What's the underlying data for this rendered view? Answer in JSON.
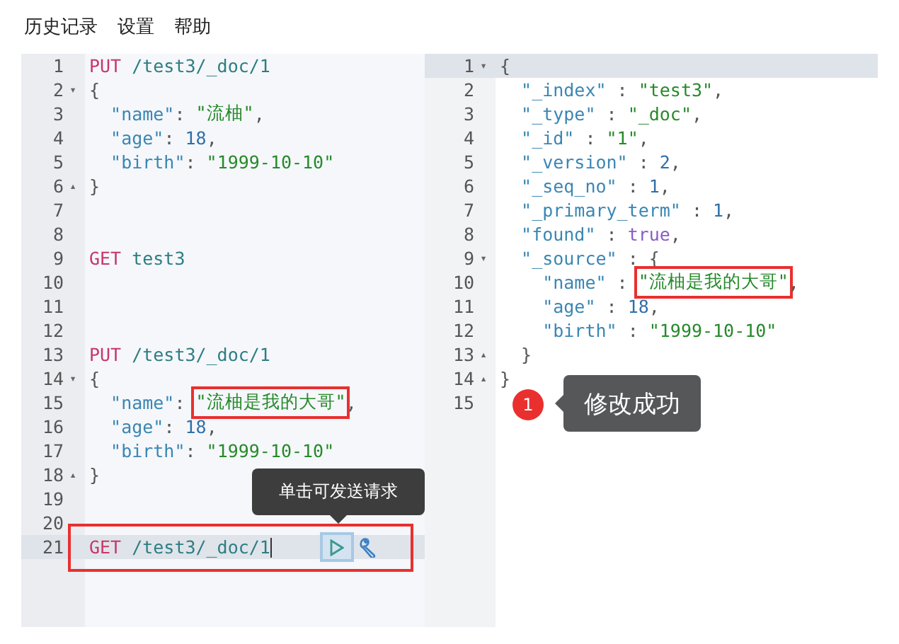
{
  "menu": [
    {
      "label": "历史记录"
    },
    {
      "label": "设置"
    },
    {
      "label": "帮助"
    }
  ],
  "request_editor": {
    "action_tooltip": "单击可发送请求",
    "lines": [
      {
        "number": "1",
        "selected": false,
        "tokens": [
          {
            "kind": "method",
            "text": "PUT"
          },
          {
            "kind": "url",
            "text": " /test3/_doc/1"
          }
        ]
      },
      {
        "number": "2",
        "selected": false,
        "fold": "▾",
        "tokens": [
          {
            "kind": "punct",
            "text": "{"
          }
        ]
      },
      {
        "number": "3",
        "selected": false,
        "tokens": [
          {
            "kind": "key",
            "text": "  \"name\""
          },
          {
            "kind": "punct",
            "text": ": "
          },
          {
            "kind": "string",
            "text": "\"流柚\""
          },
          {
            "kind": "punct",
            "text": ","
          }
        ]
      },
      {
        "number": "4",
        "selected": false,
        "tokens": [
          {
            "kind": "key",
            "text": "  \"age\""
          },
          {
            "kind": "punct",
            "text": ": "
          },
          {
            "kind": "number",
            "text": "18"
          },
          {
            "kind": "punct",
            "text": ","
          }
        ]
      },
      {
        "number": "5",
        "selected": false,
        "tokens": [
          {
            "kind": "key",
            "text": "  \"birth\""
          },
          {
            "kind": "punct",
            "text": ": "
          },
          {
            "kind": "string",
            "text": "\"1999-10-10\""
          }
        ]
      },
      {
        "number": "6",
        "selected": false,
        "fold": "▴",
        "tokens": [
          {
            "kind": "punct",
            "text": "}"
          }
        ]
      },
      {
        "number": "7",
        "selected": false
      },
      {
        "number": "8",
        "selected": false
      },
      {
        "number": "9",
        "selected": false,
        "tokens": [
          {
            "kind": "method",
            "text": "GET"
          },
          {
            "kind": "url",
            "text": " test3"
          }
        ]
      },
      {
        "number": "10",
        "selected": false
      },
      {
        "number": "11",
        "selected": false
      },
      {
        "number": "12",
        "selected": false
      },
      {
        "number": "13",
        "selected": false,
        "tokens": [
          {
            "kind": "method",
            "text": "PUT"
          },
          {
            "kind": "url",
            "text": " /test3/_doc/1"
          }
        ]
      },
      {
        "number": "14",
        "selected": false,
        "fold": "▾",
        "tokens": [
          {
            "kind": "punct",
            "text": "{"
          }
        ]
      },
      {
        "number": "15",
        "selected": false,
        "tokens": [
          {
            "kind": "key",
            "text": "  \"name\""
          },
          {
            "kind": "punct",
            "text": ": "
          },
          {
            "kind": "framed",
            "text": "\"流柚是我的大哥\""
          },
          {
            "kind": "punct",
            "text": ","
          }
        ]
      },
      {
        "number": "16",
        "selected": false,
        "tokens": [
          {
            "kind": "key",
            "text": "  \"age\""
          },
          {
            "kind": "punct",
            "text": ": "
          },
          {
            "kind": "number",
            "text": "18"
          },
          {
            "kind": "punct",
            "text": ","
          }
        ]
      },
      {
        "number": "17",
        "selected": false,
        "tokens": [
          {
            "kind": "key",
            "text": "  \"birth\""
          },
          {
            "kind": "punct",
            "text": ": "
          },
          {
            "kind": "string",
            "text": "\"1999-10-10\""
          }
        ]
      },
      {
        "number": "18",
        "selected": false,
        "fold": "▴",
        "tokens": [
          {
            "kind": "punct",
            "text": "}"
          }
        ]
      },
      {
        "number": "19",
        "selected": false
      },
      {
        "number": "20",
        "selected": false
      },
      {
        "number": "21",
        "selected": true,
        "tokens": [
          {
            "kind": "method",
            "text": "GET"
          },
          {
            "kind": "url",
            "text": " /test3/_doc/1"
          }
        ]
      }
    ]
  },
  "response_editor": {
    "callout": {
      "badge": "1",
      "text": "修改成功"
    },
    "lines": [
      {
        "number": "1",
        "selected": true,
        "fold": "▾",
        "tokens": [
          {
            "kind": "punct",
            "text": "{"
          }
        ]
      },
      {
        "number": "2",
        "selected": false,
        "tokens": [
          {
            "kind": "key",
            "text": "  \"_index\""
          },
          {
            "kind": "punct",
            "text": " : "
          },
          {
            "kind": "string",
            "text": "\"test3\""
          },
          {
            "kind": "punct",
            "text": ","
          }
        ]
      },
      {
        "number": "3",
        "selected": false,
        "tokens": [
          {
            "kind": "key",
            "text": "  \"_type\""
          },
          {
            "kind": "punct",
            "text": " : "
          },
          {
            "kind": "string",
            "text": "\"_doc\""
          },
          {
            "kind": "punct",
            "text": ","
          }
        ]
      },
      {
        "number": "4",
        "selected": false,
        "tokens": [
          {
            "kind": "key",
            "text": "  \"_id\""
          },
          {
            "kind": "punct",
            "text": " : "
          },
          {
            "kind": "string",
            "text": "\"1\""
          },
          {
            "kind": "punct",
            "text": ","
          }
        ]
      },
      {
        "number": "5",
        "selected": false,
        "tokens": [
          {
            "kind": "key",
            "text": "  \"_version\""
          },
          {
            "kind": "punct",
            "text": " : "
          },
          {
            "kind": "number",
            "text": "2"
          },
          {
            "kind": "punct",
            "text": ","
          }
        ]
      },
      {
        "number": "6",
        "selected": false,
        "tokens": [
          {
            "kind": "key",
            "text": "  \"_seq_no\""
          },
          {
            "kind": "punct",
            "text": " : "
          },
          {
            "kind": "number",
            "text": "1"
          },
          {
            "kind": "punct",
            "text": ","
          }
        ]
      },
      {
        "number": "7",
        "selected": false,
        "tokens": [
          {
            "kind": "key",
            "text": "  \"_primary_term\""
          },
          {
            "kind": "punct",
            "text": " : "
          },
          {
            "kind": "number",
            "text": "1"
          },
          {
            "kind": "punct",
            "text": ","
          }
        ]
      },
      {
        "number": "8",
        "selected": false,
        "tokens": [
          {
            "kind": "key",
            "text": "  \"found\""
          },
          {
            "kind": "punct",
            "text": " : "
          },
          {
            "kind": "boolean",
            "text": "true"
          },
          {
            "kind": "punct",
            "text": ","
          }
        ]
      },
      {
        "number": "9",
        "selected": false,
        "fold": "▾",
        "tokens": [
          {
            "kind": "key",
            "text": "  \"_source\""
          },
          {
            "kind": "punct",
            "text": " : {"
          }
        ]
      },
      {
        "number": "10",
        "selected": false,
        "tokens": [
          {
            "kind": "key",
            "text": "    \"name\""
          },
          {
            "kind": "punct",
            "text": " : "
          },
          {
            "kind": "framed",
            "text": "\"流柚是我的大哥\""
          },
          {
            "kind": "punct",
            "text": ","
          }
        ]
      },
      {
        "number": "11",
        "selected": false,
        "tokens": [
          {
            "kind": "key",
            "text": "    \"age\""
          },
          {
            "kind": "punct",
            "text": " : "
          },
          {
            "kind": "number",
            "text": "18"
          },
          {
            "kind": "punct",
            "text": ","
          }
        ]
      },
      {
        "number": "12",
        "selected": false,
        "tokens": [
          {
            "kind": "key",
            "text": "    \"birth\""
          },
          {
            "kind": "punct",
            "text": " : "
          },
          {
            "kind": "string",
            "text": "\"1999-10-10\""
          }
        ]
      },
      {
        "number": "13",
        "selected": false,
        "fold": "▴",
        "tokens": [
          {
            "kind": "punct",
            "text": "  }"
          }
        ]
      },
      {
        "number": "14",
        "selected": false,
        "fold": "▴",
        "tokens": [
          {
            "kind": "punct",
            "text": "}"
          }
        ]
      },
      {
        "number": "15",
        "selected": false
      }
    ]
  }
}
